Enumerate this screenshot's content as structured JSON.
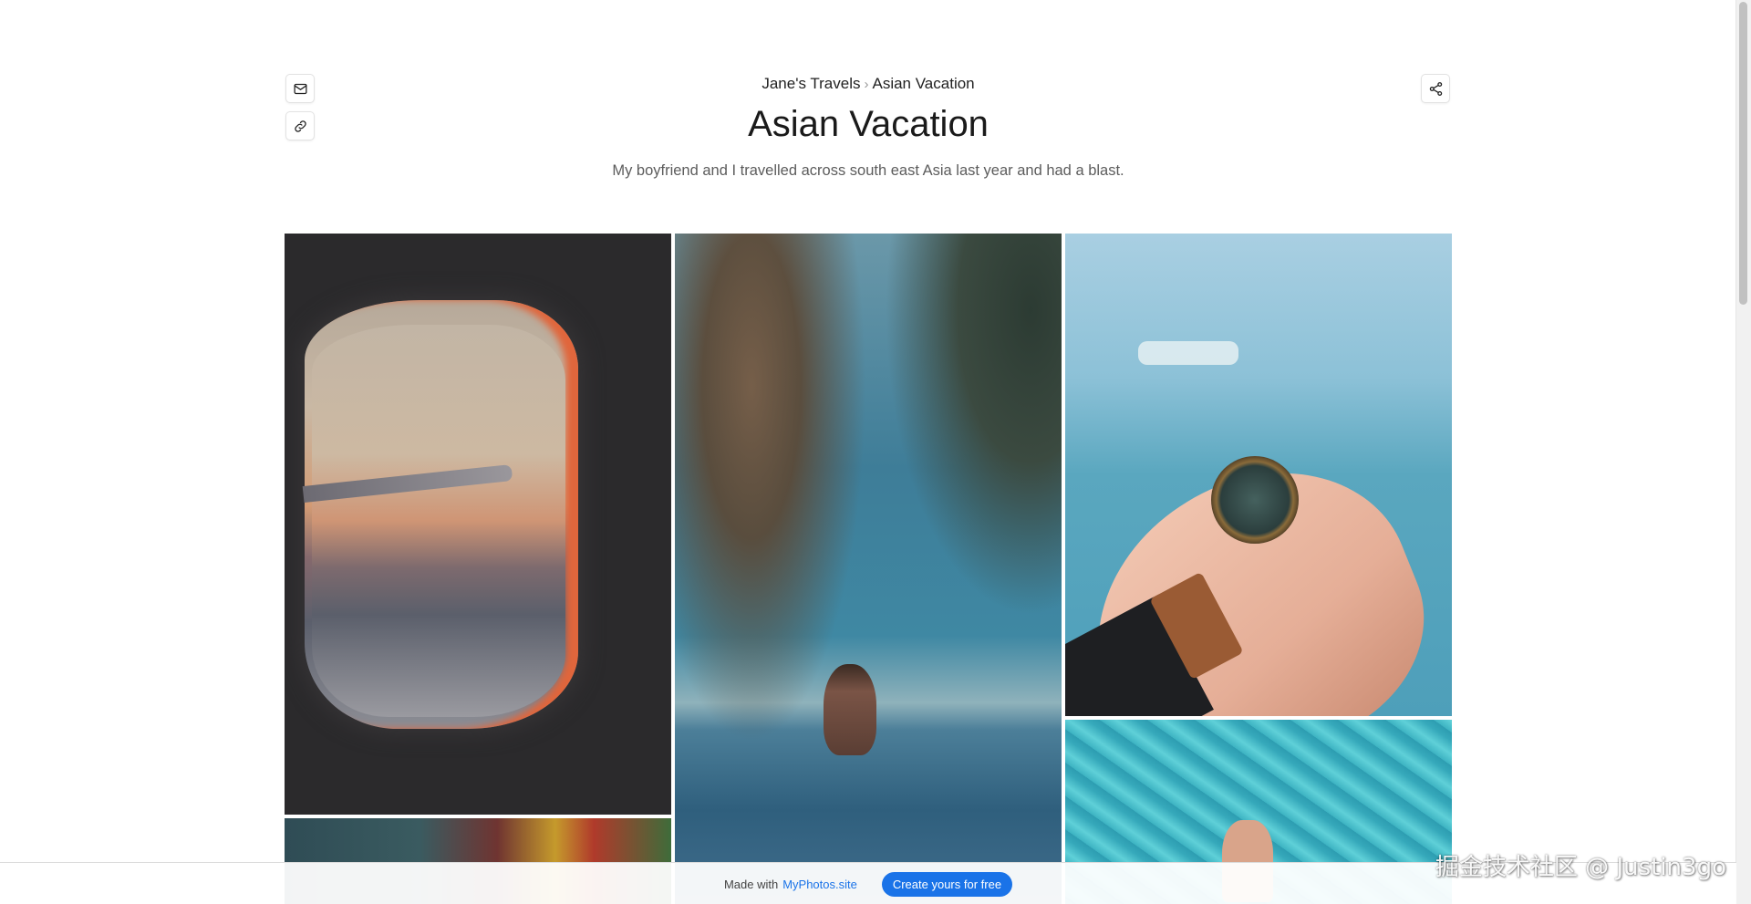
{
  "header": {
    "breadcrumb": {
      "parent": "Jane's Travels",
      "separator": "›",
      "current": "Asian Vacation"
    },
    "title": "Asian Vacation",
    "description": "My boyfriend and I travelled across south east Asia last year and had a blast."
  },
  "actions": {
    "email_icon": "mail-icon",
    "link_icon": "link-icon",
    "share_icon": "share-icon"
  },
  "gallery": {
    "photos": [
      {
        "id": "airplane-window",
        "subject": "airplane-window"
      },
      {
        "id": "infinity-pool",
        "subject": "infinity-pool"
      },
      {
        "id": "compass-in-hand",
        "subject": "compass-in-hand"
      },
      {
        "id": "luggage",
        "subject": "luggage"
      },
      {
        "id": "pool-water",
        "subject": "pool-water"
      }
    ]
  },
  "footer_bar": {
    "made_with": "Made with",
    "site_name": "MyPhotos.site",
    "cta_label": "Create yours for free"
  },
  "watermark": "掘金技术社区 @ Justin3go",
  "colors": {
    "accent": "#1a73e8",
    "text": "#1a1a1a",
    "muted": "#5c5c5c"
  }
}
